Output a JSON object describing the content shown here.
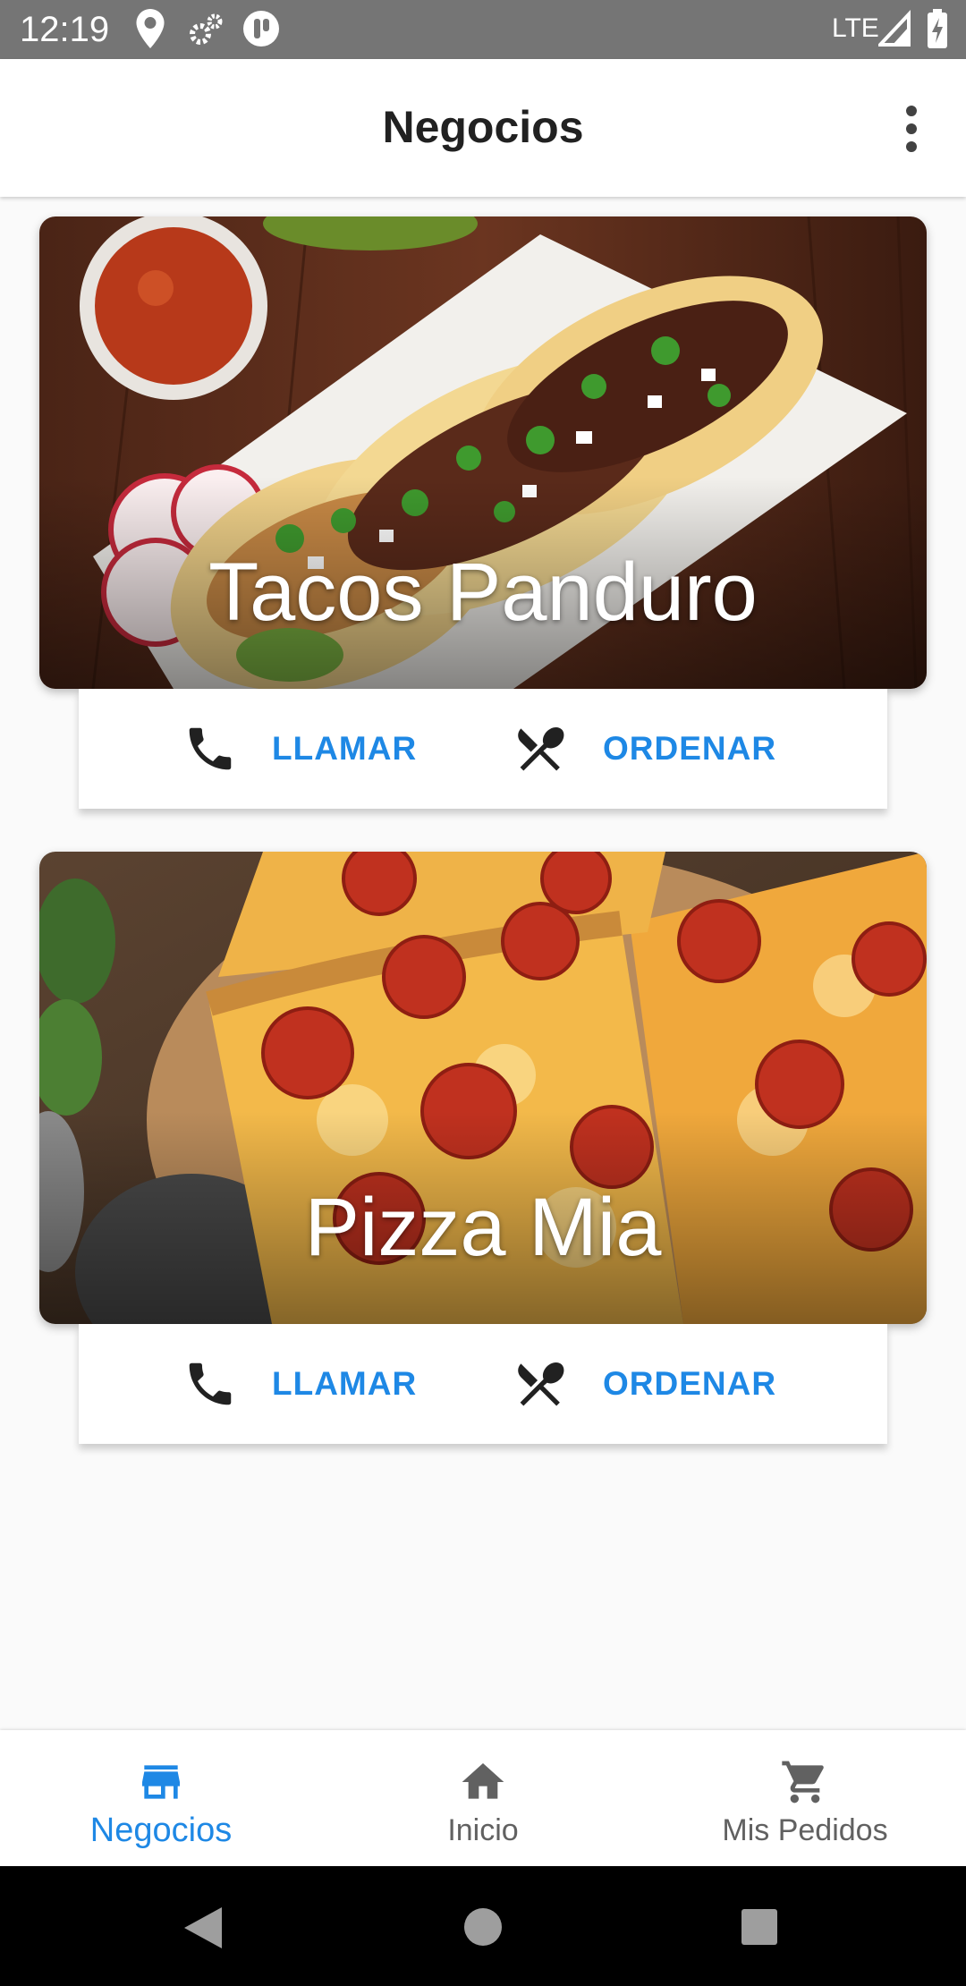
{
  "status_bar": {
    "time": "12:19",
    "network": "LTE"
  },
  "app_bar": {
    "title": "Negocios",
    "menu_icon": "more-vert-icon"
  },
  "businesses": [
    {
      "name": "Tacos Panduro",
      "call_label": "LLAMAR",
      "order_label": "ORDENAR"
    },
    {
      "name": "Pizza Mia",
      "call_label": "LLAMAR",
      "order_label": "ORDENAR"
    }
  ],
  "bottom_nav": {
    "items": [
      {
        "label": "Negocios",
        "icon": "store-icon",
        "active": true
      },
      {
        "label": "Inicio",
        "icon": "home-icon",
        "active": false
      },
      {
        "label": "Mis Pedidos",
        "icon": "cart-icon",
        "active": false
      }
    ]
  },
  "colors": {
    "accent": "#1e88e5",
    "inactive": "#616161",
    "status_bar": "#757575"
  }
}
